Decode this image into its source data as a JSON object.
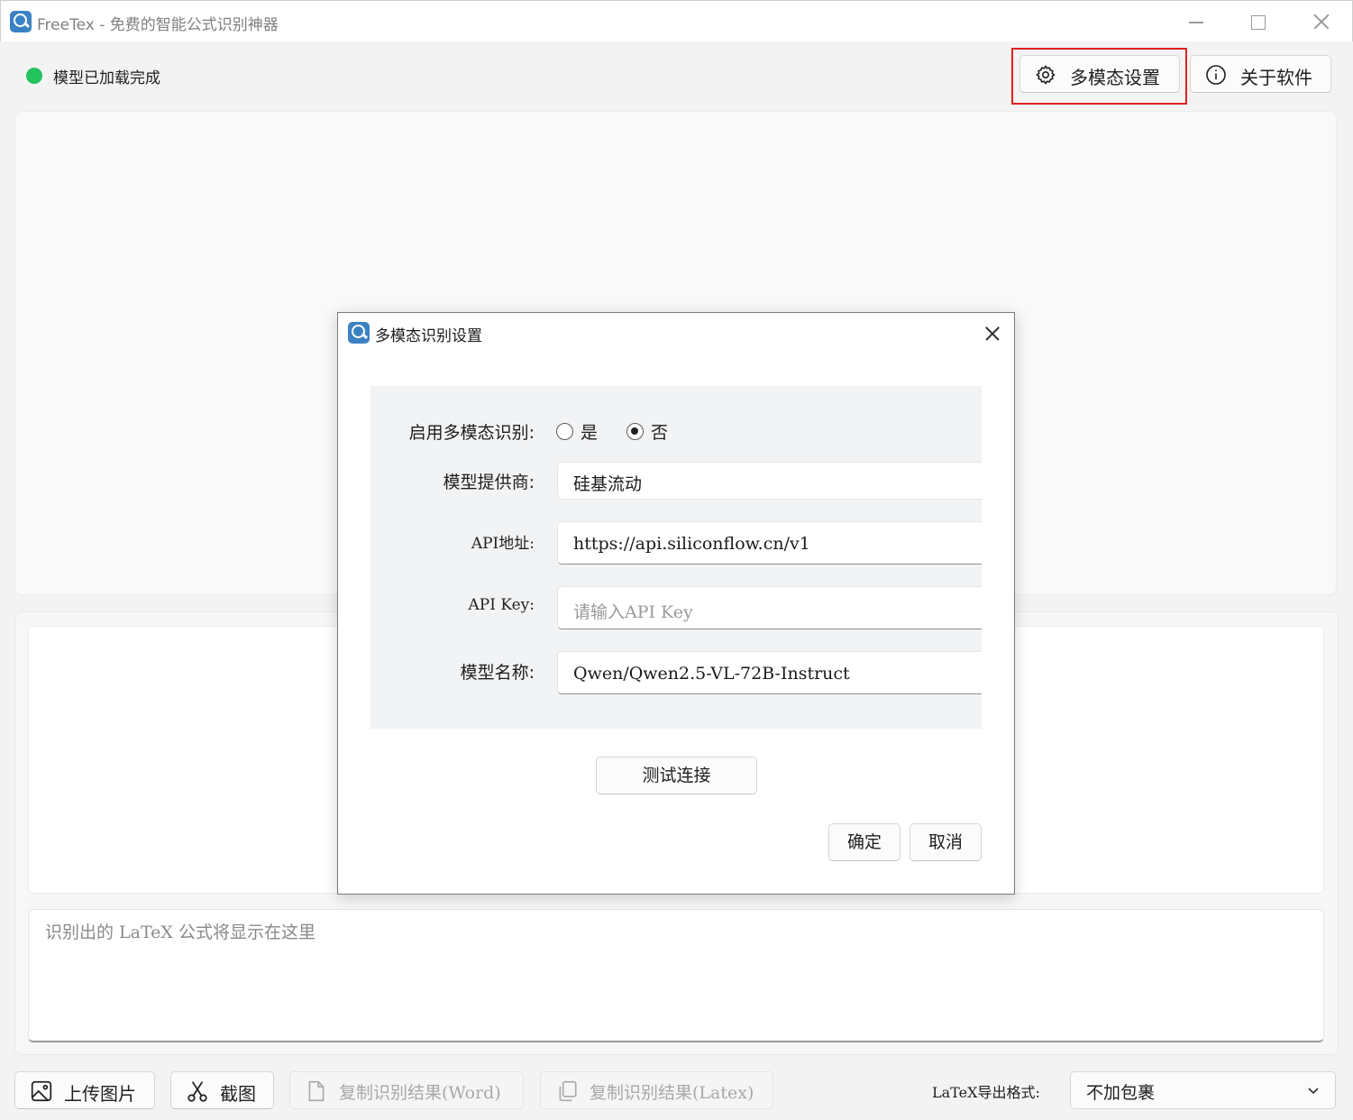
{
  "window": {
    "title": "FreeTex - 免费的智能公式识别神器"
  },
  "status": {
    "text": "模型已加载完成",
    "color": "#22c35e"
  },
  "toolbar": {
    "settings_label": "多模态设置",
    "settings_icon": "gear-icon",
    "about_label": "关于软件",
    "about_icon": "info-icon",
    "highlight_color": "#e02020"
  },
  "latex": {
    "placeholder": "识别出的 LaTeX 公式将显示在这里"
  },
  "bottom": {
    "upload_label": "上传图片",
    "crop_label": "截图",
    "copy_word_label": "复制识别结果(Word)",
    "copy_latex_label": "复制识别结果(Latex)",
    "format_label": "LaTeX导出格式:",
    "format_value": "不加包裹"
  },
  "dialog": {
    "title": "多模态识别设置",
    "enable_label": "启用多模态识别:",
    "option_yes": "是",
    "option_no": "否",
    "selected": "否",
    "provider_label": "模型提供商:",
    "provider_value": "硅基流动",
    "api_url_label": "API地址:",
    "api_url_value": "https://api.siliconflow.cn/v1",
    "api_key_label": "API Key:",
    "api_key_placeholder": "请输入API Key",
    "model_label": "模型名称:",
    "model_value": "Qwen/Qwen2.5-VL-72B-Instruct",
    "test_label": "测试连接",
    "ok_label": "确定",
    "cancel_label": "取消"
  }
}
